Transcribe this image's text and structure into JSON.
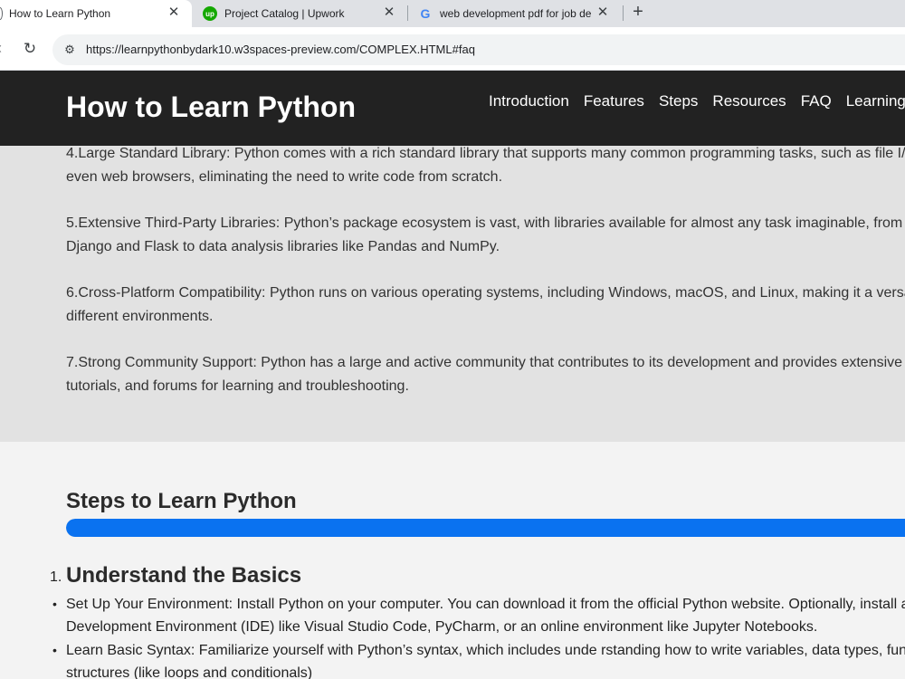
{
  "browser": {
    "tabs": [
      {
        "title": "How to Learn Python",
        "favicon": "python-page-icon",
        "active": true
      },
      {
        "title": "Project Catalog | Upwork",
        "favicon": "upwork-icon",
        "active": false
      },
      {
        "title": "web development pdf for job de",
        "favicon": "google-icon",
        "active": false
      }
    ],
    "upwork_favicon_text": "up",
    "google_favicon_text": "G",
    "url": "https://learnpythonbydark10.w3spaces-preview.com/COMPLEX.HTML#faq"
  },
  "header": {
    "title": "How to Learn Python",
    "nav": [
      "Introduction",
      "Features",
      "Steps",
      "Resources",
      "FAQ",
      "Learning Pa"
    ]
  },
  "features": [
    {
      "l1": "4.Large Standard Library: Python comes with a rich standard library that supports many common programming tasks, such as file I/",
      "l2": "even web browsers, eliminating the need to write code from scratch."
    },
    {
      "l1": "5.Extensive Third-Party Libraries: Python’s package ecosystem is vast, with libraries available for almost any task imaginable, from",
      "l2": "Django and Flask to data analysis libraries like Pandas and NumPy."
    },
    {
      "l1": "6.Cross-Platform Compatibility: Python runs on various operating systems, including Windows, macOS, and Linux, making it a versa",
      "l2": "different environments."
    },
    {
      "l1": "7.Strong Community Support: Python has a large and active community that contributes to its development and provides extensive",
      "l2": "tutorials, and forums for learning and troubleshooting."
    }
  ],
  "steps": {
    "title": "Steps to Learn Python",
    "progress_percent": 100,
    "accent_color": "#0a72f0",
    "item_number": "1.",
    "item_title": "Understand the Basics",
    "bullets": [
      {
        "l1": "Set Up Your Environment: Install Python on your computer. You can download it from the official Python website. Optionally, install a",
        "l2": "Development Environment (IDE) like Visual Studio Code, PyCharm, or an online environment like Jupyter Notebooks."
      },
      {
        "l1": "Learn Basic Syntax: Familiarize yourself with Python’s syntax, which includes unde rstanding how to write variables, data types, fun",
        "l2": "structures (like loops and conditionals)"
      }
    ]
  }
}
